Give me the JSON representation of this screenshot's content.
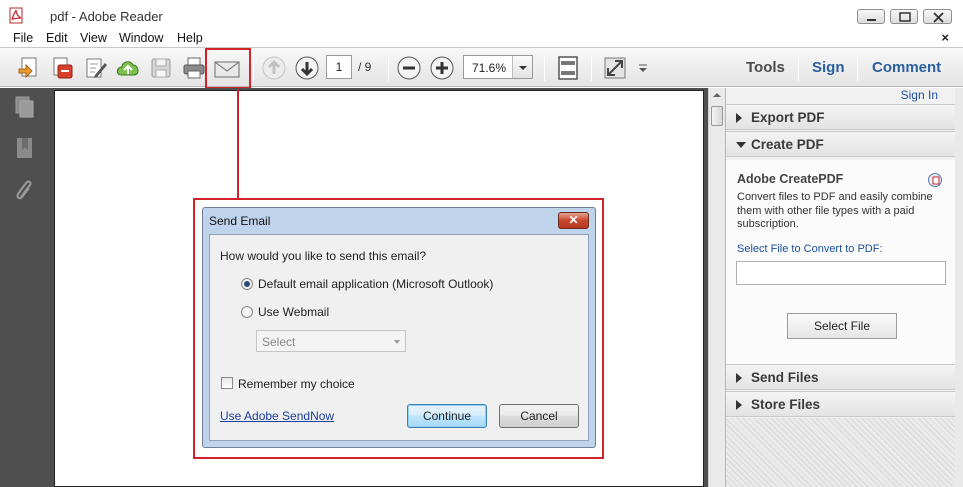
{
  "window": {
    "title": "pdf - Adobe Reader"
  },
  "menu": [
    "File",
    "Edit",
    "View",
    "Window",
    "Help"
  ],
  "menu_close": "×",
  "toolbar": {
    "page_current": "1",
    "page_total": "/ 9",
    "zoom": "71.6%",
    "tools_label": "Tools",
    "sign_label": "Sign",
    "comment_label": "Comment"
  },
  "right_pane": {
    "sign_in": "Sign In",
    "sections": {
      "export_pdf": "Export PDF",
      "create_pdf": "Create PDF",
      "send_files": "Send Files",
      "store_files": "Store Files"
    },
    "create": {
      "title": "Adobe CreatePDF",
      "description": "Convert files to PDF and easily combine them with other file types with a paid subscription.",
      "select_label": "Select File to Convert to PDF:",
      "select_button": "Select File"
    }
  },
  "dialog": {
    "title": "Send Email",
    "close": "✕",
    "question": "How would you like to send this email?",
    "option_default": "Default email application (Microsoft Outlook)",
    "option_webmail": "Use Webmail",
    "webmail_placeholder": "Select",
    "remember": "Remember my choice",
    "sendnow_link": "Use Adobe SendNow",
    "continue": "Continue",
    "cancel": "Cancel"
  },
  "colors": {
    "highlight": "#d2232a",
    "link": "#1a4f9c"
  },
  "icons": [
    "pdf-app-icon",
    "open-icon",
    "create-icon",
    "edit-icon",
    "upload-icon",
    "save-icon",
    "print-icon",
    "email-icon",
    "prev-page-icon",
    "next-page-icon",
    "zoom-out-icon",
    "zoom-in-icon",
    "fit-page-icon",
    "fullscreen-icon",
    "more-icon",
    "pages-icon",
    "bookmarks-icon",
    "attachments-icon"
  ]
}
